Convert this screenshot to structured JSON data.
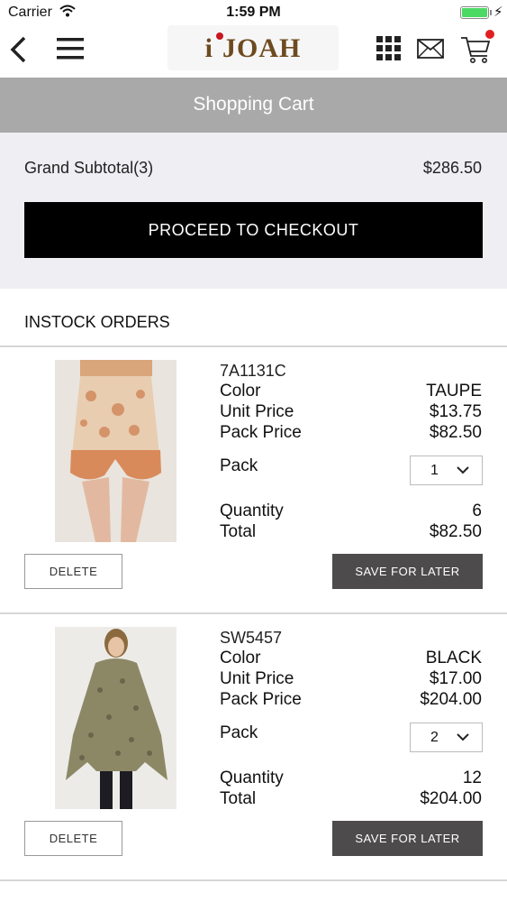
{
  "status_bar": {
    "carrier": "Carrier",
    "time": "1:59 PM",
    "battery_level": 1.0
  },
  "nav": {
    "logo_text": "JOAH",
    "icons": [
      "back-icon",
      "menu-icon",
      "grid-icon",
      "mail-icon",
      "cart-icon"
    ],
    "cart_badge_color": "#e02020"
  },
  "header": {
    "title": "Shopping Cart"
  },
  "summary": {
    "label": "Grand Subtotal(3)",
    "amount": "$286.50",
    "checkout_label": "PROCEED TO CHECKOUT"
  },
  "section": {
    "title": "INSTOCK ORDERS"
  },
  "labels": {
    "color": "Color",
    "unit_price": "Unit Price",
    "pack_price": "Pack Price",
    "pack": "Pack",
    "quantity": "Quantity",
    "total": "Total",
    "delete": "DELETE",
    "save_for_later": "SAVE FOR LATER"
  },
  "items": [
    {
      "sku": "7A1131C",
      "color": "TAUPE",
      "unit_price": "$13.75",
      "pack_price": "$82.50",
      "pack": "1",
      "quantity": "6",
      "total": "$82.50"
    },
    {
      "sku": "SW5457",
      "color": "BLACK",
      "unit_price": "$17.00",
      "pack_price": "$204.00",
      "pack": "2",
      "quantity": "12",
      "total": "$204.00"
    }
  ],
  "colors": {
    "title_bar": "#a9a9a9",
    "summary_bg": "#eeeef3",
    "checkout_btn": "#000000",
    "save_btn": "#4d4b4b",
    "logo": "#6e4a1f",
    "logo_dot": "#c8171f",
    "battery": "#4cd964"
  }
}
